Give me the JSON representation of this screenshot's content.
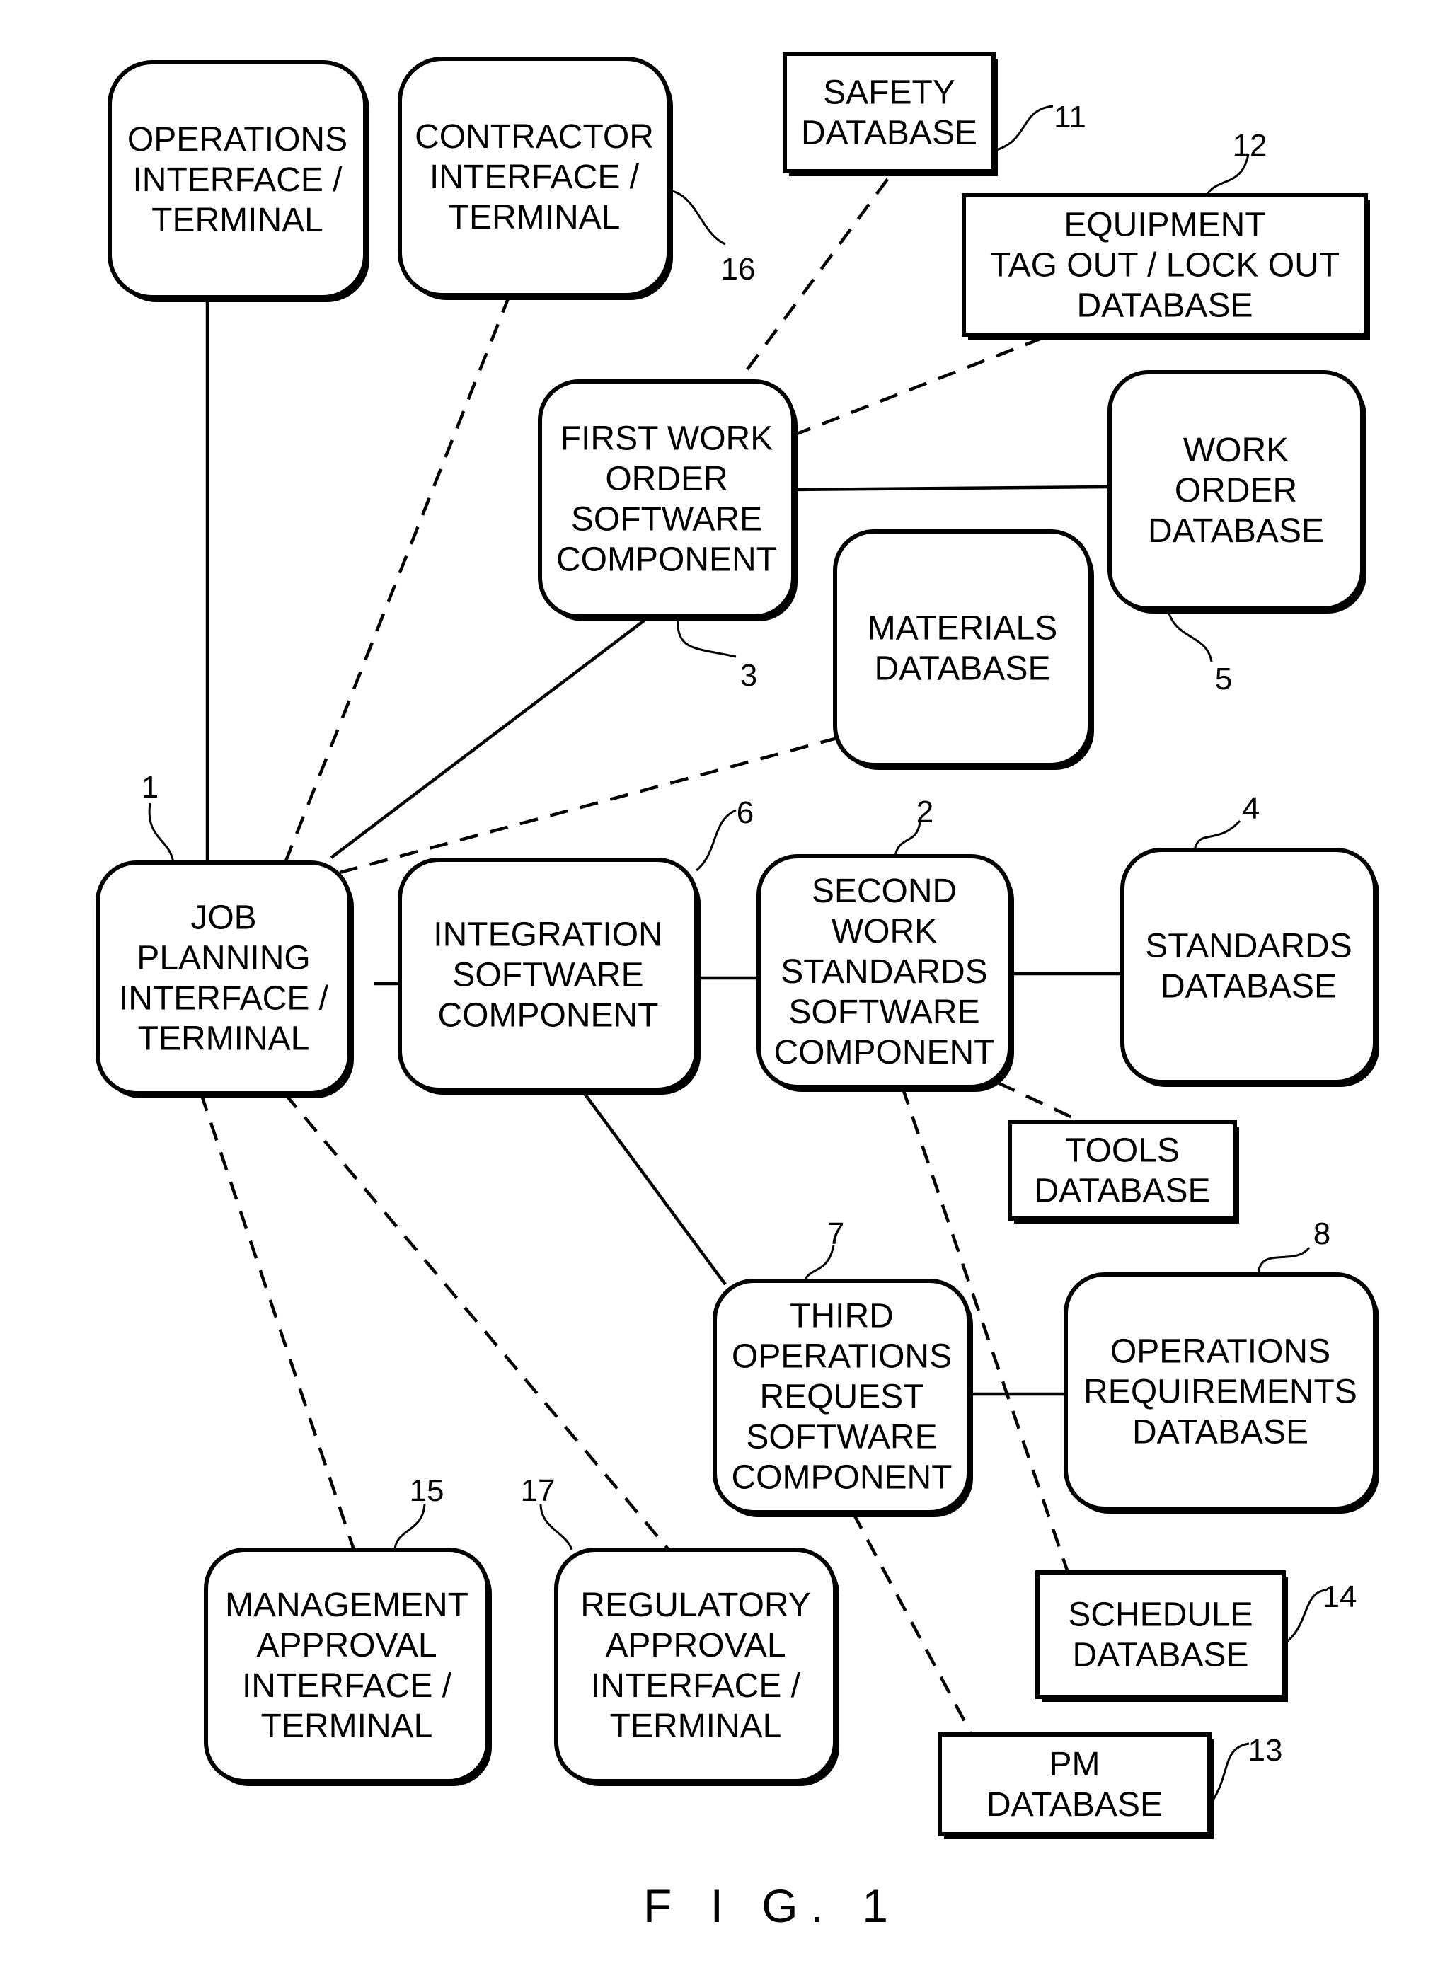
{
  "figure": {
    "caption": "F I G. 1"
  },
  "nodes": [
    {
      "id": "operations_interface",
      "ref": "",
      "shape": "rounded",
      "lines": [
        "OPERATIONS",
        "INTERFACE /",
        "TERMINAL"
      ]
    },
    {
      "id": "contractor_interface",
      "ref": "16",
      "shape": "rounded",
      "lines": [
        "CONTRACTOR",
        "INTERFACE /",
        "TERMINAL"
      ]
    },
    {
      "id": "safety_db",
      "ref": "11",
      "shape": "rect",
      "lines": [
        "SAFETY",
        "DATABASE"
      ]
    },
    {
      "id": "equipment_db",
      "ref": "12",
      "shape": "rect",
      "lines": [
        "EQUIPMENT",
        "TAG OUT / LOCK OUT",
        "DATABASE"
      ]
    },
    {
      "id": "first_work_order",
      "ref": "3",
      "shape": "rounded",
      "lines": [
        "FIRST WORK",
        "ORDER",
        "SOFTWARE",
        "COMPONENT"
      ]
    },
    {
      "id": "work_order_db",
      "ref": "5",
      "shape": "rounded",
      "lines": [
        "WORK",
        "ORDER",
        "DATABASE"
      ]
    },
    {
      "id": "materials_db",
      "ref": "",
      "shape": "rounded",
      "lines": [
        "MATERIALS",
        "DATABASE"
      ]
    },
    {
      "id": "job_planning",
      "ref": "1",
      "shape": "rounded",
      "lines": [
        "JOB",
        "PLANNING",
        "INTERFACE /",
        "TERMINAL"
      ]
    },
    {
      "id": "integration",
      "ref": "6",
      "shape": "rounded",
      "lines": [
        "INTEGRATION",
        "SOFTWARE",
        "COMPONENT"
      ]
    },
    {
      "id": "second_work_standards",
      "ref": "2",
      "shape": "rounded",
      "lines": [
        "SECOND",
        "WORK",
        "STANDARDS",
        "SOFTWARE",
        "COMPONENT"
      ]
    },
    {
      "id": "standards_db",
      "ref": "4",
      "shape": "rounded",
      "lines": [
        "STANDARDS",
        "DATABASE"
      ]
    },
    {
      "id": "tools_db",
      "ref": "",
      "shape": "rect",
      "lines": [
        "TOOLS",
        "DATABASE"
      ]
    },
    {
      "id": "third_operations",
      "ref": "7",
      "shape": "rounded",
      "lines": [
        "THIRD",
        "OPERATIONS",
        "REQUEST",
        "SOFTWARE",
        "COMPONENT"
      ]
    },
    {
      "id": "operations_requirements_db",
      "ref": "8",
      "shape": "rounded",
      "lines": [
        "OPERATIONS",
        "REQUIREMENTS",
        "DATABASE"
      ]
    },
    {
      "id": "management_approval",
      "ref": "15",
      "shape": "rounded",
      "lines": [
        "MANAGEMENT",
        "APPROVAL",
        "INTERFACE /",
        "TERMINAL"
      ]
    },
    {
      "id": "regulatory_approval",
      "ref": "17",
      "shape": "rounded",
      "lines": [
        "REGULATORY",
        "APPROVAL",
        "INTERFACE /",
        "TERMINAL"
      ]
    },
    {
      "id": "schedule_db",
      "ref": "14",
      "shape": "rect",
      "lines": [
        "SCHEDULE",
        "DATABASE"
      ]
    },
    {
      "id": "pm_db",
      "ref": "13",
      "shape": "rect",
      "lines": [
        "PM",
        "DATABASE"
      ]
    }
  ],
  "edges": [
    {
      "from": "job_planning",
      "to": "operations_interface",
      "style": "solid"
    },
    {
      "from": "job_planning",
      "to": "contractor_interface",
      "style": "dashed"
    },
    {
      "from": "job_planning",
      "to": "first_work_order",
      "style": "solid"
    },
    {
      "from": "job_planning",
      "to": "materials_db",
      "style": "dashed"
    },
    {
      "from": "job_planning",
      "to": "integration",
      "style": "solid"
    },
    {
      "from": "job_planning",
      "to": "management_approval",
      "style": "dashed"
    },
    {
      "from": "job_planning",
      "to": "regulatory_approval",
      "style": "dashed"
    },
    {
      "from": "first_work_order",
      "to": "safety_db",
      "style": "dashed"
    },
    {
      "from": "first_work_order",
      "to": "equipment_db",
      "style": "dashed"
    },
    {
      "from": "first_work_order",
      "to": "work_order_db",
      "style": "solid"
    },
    {
      "from": "integration",
      "to": "second_work_standards",
      "style": "solid"
    },
    {
      "from": "integration",
      "to": "third_operations",
      "style": "solid"
    },
    {
      "from": "second_work_standards",
      "to": "standards_db",
      "style": "solid"
    },
    {
      "from": "second_work_standards",
      "to": "tools_db",
      "style": "dashed"
    },
    {
      "from": "second_work_standards",
      "to": "schedule_db",
      "style": "dashed"
    },
    {
      "from": "third_operations",
      "to": "operations_requirements_db",
      "style": "solid"
    },
    {
      "from": "third_operations",
      "to": "pm_db",
      "style": "dashed"
    }
  ]
}
